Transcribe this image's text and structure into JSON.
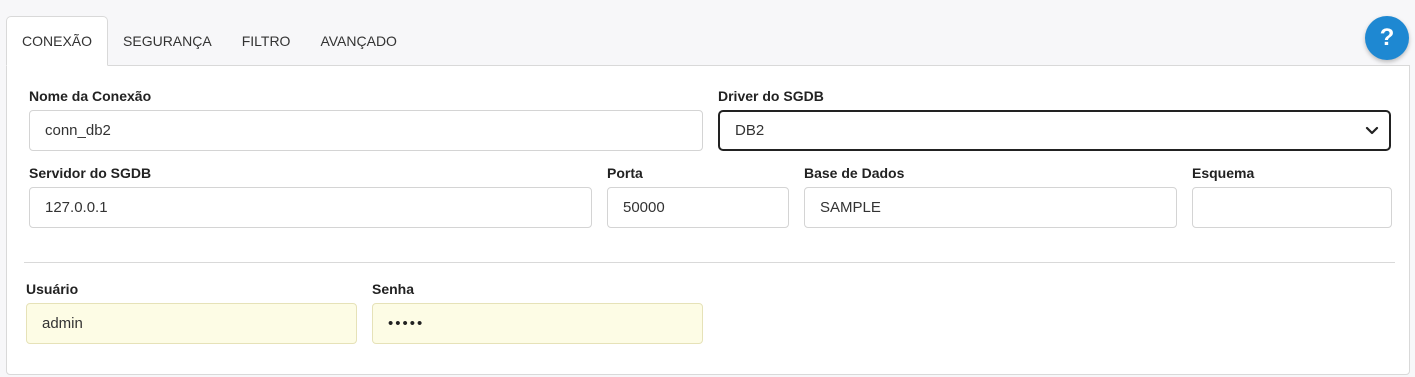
{
  "tabs": [
    {
      "label": "CONEXÃO",
      "active": true
    },
    {
      "label": "SEGURANÇA",
      "active": false
    },
    {
      "label": "FILTRO",
      "active": false
    },
    {
      "label": "AVANÇADO",
      "active": false
    }
  ],
  "help": {
    "label": "?",
    "icon": "help-icon",
    "color": "#1e88d2"
  },
  "form": {
    "connection_name": {
      "label": "Nome da Conexão",
      "value": "conn_db2"
    },
    "driver": {
      "label": "Driver do SGDB",
      "value": "DB2"
    },
    "server": {
      "label": "Servidor do SGDB",
      "value": "127.0.0.1"
    },
    "port": {
      "label": "Porta",
      "value": "50000"
    },
    "database": {
      "label": "Base de Dados",
      "value": "SAMPLE"
    },
    "schema": {
      "label": "Esquema",
      "value": ""
    },
    "user": {
      "label": "Usuário",
      "value": "admin"
    },
    "password": {
      "label": "Senha",
      "value": "•••••"
    }
  },
  "colors": {
    "autofill_bg": "#fdfce5",
    "accent": "#1e88d2"
  }
}
